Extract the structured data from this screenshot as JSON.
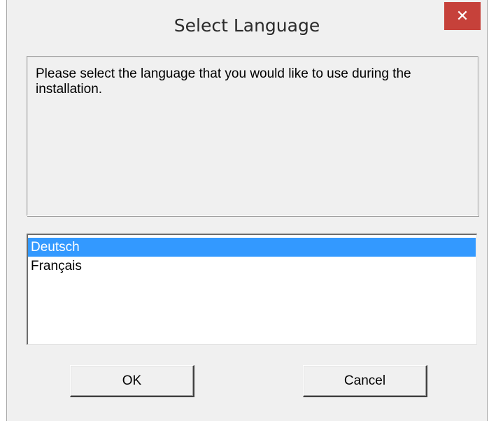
{
  "window": {
    "title": "Select Language",
    "close_glyph": "✕"
  },
  "message": {
    "text": "Please select the language that you would like to use during the installation."
  },
  "language_list": {
    "items": [
      {
        "label": "Deutsch",
        "selected": true
      },
      {
        "label": "Français",
        "selected": false
      }
    ]
  },
  "buttons": {
    "ok_label": "OK",
    "cancel_label": "Cancel"
  },
  "colors": {
    "selection": "#3399ff",
    "close_button": "#c6413a",
    "dialog_background": "#f0f0f0"
  },
  "icons": {
    "close": "close-icon"
  }
}
